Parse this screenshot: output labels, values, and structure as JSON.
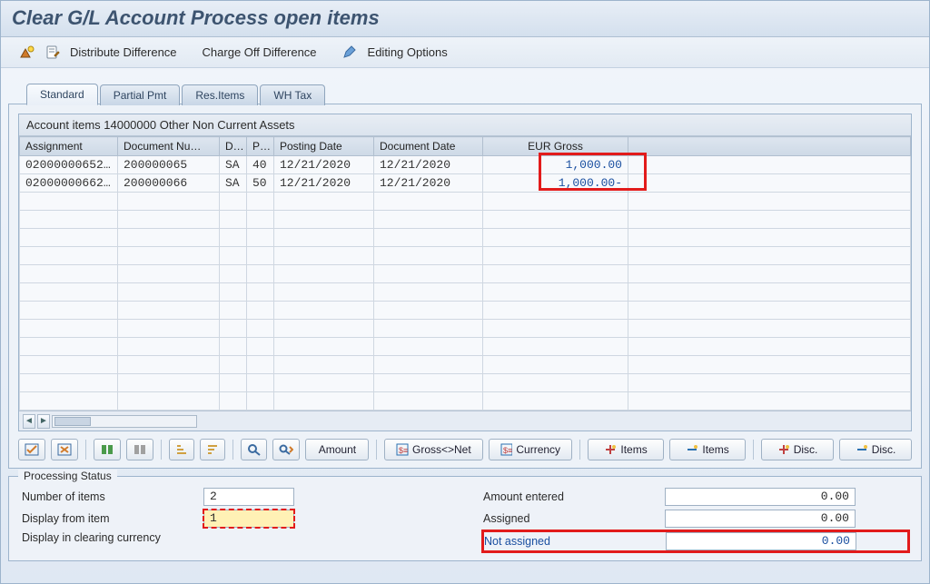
{
  "title": "Clear G/L Account Process open items",
  "toolbar": {
    "icon1": "mountain-icon",
    "icon2": "edit-doc-icon",
    "distribute_label": "Distribute Difference",
    "chargeoff_label": "Charge Off Difference",
    "pencil_icon": "pencil-icon",
    "editing_label": "Editing Options"
  },
  "tabs": [
    "Standard",
    "Partial Pmt",
    "Res.Items",
    "WH Tax"
  ],
  "active_tab_index": 0,
  "table": {
    "caption": "Account items 14000000 Other Non Current Assets",
    "columns": [
      "Assignment",
      "Document Nu…",
      "D…",
      "P…",
      "Posting Date",
      "Document Date",
      "EUR Gross"
    ],
    "rows": [
      {
        "assignment": "02000000652…",
        "docnum": "200000065",
        "dtype": "SA",
        "pk": "40",
        "pdate": "12/21/2020",
        "ddate": "12/21/2020",
        "amount": "1,000.00 "
      },
      {
        "assignment": "02000000662…",
        "docnum": "200000066",
        "dtype": "SA",
        "pk": "50",
        "pdate": "12/21/2020",
        "ddate": "12/21/2020",
        "amount": "1,000.00-"
      }
    ],
    "empty_rows": 12
  },
  "btnbar": {
    "amount_label": "Amount",
    "grossnet_label": "Gross<>Net",
    "currency_label": "Currency",
    "items_label": "Items",
    "disc_label": "Disc."
  },
  "status": {
    "title": "Processing Status",
    "number_of_items_label": "Number of items",
    "number_of_items_value": "2",
    "display_from_item_label": "Display from item",
    "display_from_item_value": "1",
    "display_currency_label": "Display in clearing currency",
    "amount_entered_label": "Amount entered",
    "amount_entered_value": "0.00",
    "assigned_label": "Assigned",
    "assigned_value": "0.00",
    "not_assigned_label": "Not assigned",
    "not_assigned_value": "0.00"
  }
}
